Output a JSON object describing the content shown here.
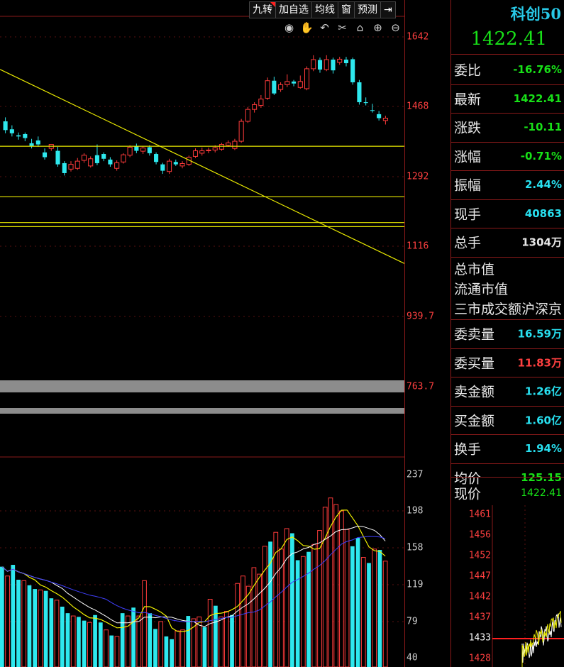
{
  "toolbar": {
    "buttons": [
      "九转",
      "加自选",
      "均线",
      "窗",
      "预测"
    ],
    "collapse_icon": "arrow-right-bar-icon"
  },
  "tools": [
    "eye-icon",
    "hand-icon",
    "undo-icon",
    "scissors-icon",
    "lock-icon",
    "zoom-in-icon",
    "zoom-out-icon"
  ],
  "price_axis": {
    "labels": [
      "1642",
      "1468",
      "1292",
      "1116",
      "939.7",
      "763.7"
    ]
  },
  "volume_axis": {
    "labels": [
      "237",
      "198",
      "158",
      "119",
      "79",
      "40"
    ]
  },
  "colors": {
    "up": "#ff3b3b",
    "down": "#2ee8ee",
    "drawn_line": "#e8e800",
    "quote_green": "#18e018",
    "quote_cyan": "#28e0f0",
    "quote_red": "#ff4040"
  },
  "chart_data": {
    "type": "candlestick",
    "price_range": [
      763.7,
      1642
    ],
    "volume_range": [
      40,
      237
    ],
    "candles": [
      [
        1430,
        1408,
        1440,
        1400,
        "down"
      ],
      [
        1410,
        1400,
        1420,
        1392,
        "down"
      ],
      [
        1395,
        1392,
        1402,
        1384,
        "down"
      ],
      [
        1398,
        1388,
        1402,
        1380,
        "down"
      ],
      [
        1375,
        1368,
        1386,
        1362,
        "down"
      ],
      [
        1382,
        1372,
        1392,
        1366,
        "down"
      ],
      [
        1352,
        1340,
        1362,
        1334,
        "down"
      ],
      [
        1362,
        1372,
        1372,
        1356,
        "up"
      ],
      [
        1356,
        1322,
        1366,
        1316,
        "down"
      ],
      [
        1325,
        1300,
        1330,
        1294,
        "down"
      ],
      [
        1310,
        1322,
        1330,
        1304,
        "up"
      ],
      [
        1312,
        1330,
        1338,
        1308,
        "up"
      ],
      [
        1332,
        1345,
        1350,
        1326,
        "up"
      ],
      [
        1318,
        1336,
        1342,
        1314,
        "up"
      ],
      [
        1345,
        1325,
        1372,
        1320,
        "down"
      ],
      [
        1348,
        1336,
        1352,
        1330,
        "down"
      ],
      [
        1334,
        1322,
        1340,
        1316,
        "down"
      ],
      [
        1312,
        1326,
        1332,
        1306,
        "up"
      ],
      [
        1328,
        1346,
        1350,
        1324,
        "up"
      ],
      [
        1345,
        1365,
        1370,
        1340,
        "up"
      ],
      [
        1368,
        1356,
        1374,
        1350,
        "down"
      ],
      [
        1355,
        1363,
        1368,
        1348,
        "up"
      ],
      [
        1365,
        1350,
        1370,
        1344,
        "down"
      ],
      [
        1348,
        1328,
        1352,
        1322,
        "down"
      ],
      [
        1322,
        1306,
        1326,
        1298,
        "down"
      ],
      [
        1304,
        1330,
        1336,
        1298,
        "up"
      ],
      [
        1328,
        1322,
        1334,
        1318,
        "down"
      ],
      [
        1318,
        1324,
        1330,
        1312,
        "up"
      ],
      [
        1322,
        1340,
        1344,
        1318,
        "up"
      ],
      [
        1342,
        1356,
        1362,
        1338,
        "up"
      ],
      [
        1350,
        1356,
        1364,
        1344,
        "up"
      ],
      [
        1356,
        1358,
        1364,
        1350,
        "up"
      ],
      [
        1358,
        1364,
        1370,
        1352,
        "up"
      ],
      [
        1360,
        1372,
        1376,
        1356,
        "up"
      ],
      [
        1370,
        1376,
        1382,
        1366,
        "up"
      ],
      [
        1362,
        1380,
        1386,
        1358,
        "up"
      ],
      [
        1380,
        1430,
        1436,
        1376,
        "up"
      ],
      [
        1430,
        1460,
        1466,
        1426,
        "up"
      ],
      [
        1460,
        1472,
        1478,
        1452,
        "up"
      ],
      [
        1470,
        1486,
        1496,
        1464,
        "up"
      ],
      [
        1488,
        1532,
        1540,
        1484,
        "up"
      ],
      [
        1532,
        1500,
        1542,
        1496,
        "down"
      ],
      [
        1510,
        1522,
        1528,
        1504,
        "up"
      ],
      [
        1522,
        1530,
        1548,
        1516,
        "up"
      ],
      [
        1530,
        1525,
        1534,
        1518,
        "down"
      ],
      [
        1515,
        1530,
        1545,
        1512,
        "up"
      ],
      [
        1512,
        1562,
        1568,
        1508,
        "up"
      ],
      [
        1562,
        1585,
        1596,
        1556,
        "up"
      ],
      [
        1584,
        1560,
        1590,
        1552,
        "down"
      ],
      [
        1560,
        1585,
        1596,
        1556,
        "up"
      ],
      [
        1585,
        1558,
        1590,
        1550,
        "down"
      ],
      [
        1578,
        1586,
        1592,
        1572,
        "up"
      ],
      [
        1585,
        1576,
        1592,
        1568,
        "down"
      ],
      [
        1586,
        1528,
        1590,
        1522,
        "down"
      ],
      [
        1528,
        1478,
        1534,
        1472,
        "down"
      ],
      [
        1478,
        1476,
        1490,
        1470,
        "down"
      ],
      [
        1458,
        1458,
        1474,
        1452,
        "down"
      ],
      [
        1448,
        1438,
        1456,
        1432,
        "down"
      ],
      [
        1438,
        1432,
        1444,
        1422,
        "up"
      ]
    ],
    "volumes": [
      [
        138,
        "down"
      ],
      [
        128,
        "up"
      ],
      [
        140,
        "down"
      ],
      [
        124,
        "down"
      ],
      [
        123,
        "up"
      ],
      [
        118,
        "down"
      ],
      [
        114,
        "down"
      ],
      [
        113,
        "up"
      ],
      [
        112,
        "down"
      ],
      [
        104,
        "down"
      ],
      [
        102,
        "up"
      ],
      [
        95,
        "down"
      ],
      [
        88,
        "down"
      ],
      [
        85,
        "up"
      ],
      [
        84,
        "down"
      ],
      [
        80,
        "down"
      ],
      [
        78,
        "up"
      ],
      [
        86,
        "down"
      ],
      [
        78,
        "down"
      ],
      [
        70,
        "up"
      ],
      [
        64,
        "down"
      ],
      [
        63,
        "up"
      ],
      [
        88,
        "down"
      ],
      [
        85,
        "up"
      ],
      [
        94,
        "down"
      ],
      [
        85,
        "up"
      ],
      [
        123,
        "up"
      ],
      [
        88,
        "down"
      ],
      [
        71,
        "down"
      ],
      [
        79,
        "up"
      ],
      [
        63,
        "down"
      ],
      [
        60,
        "down"
      ],
      [
        69,
        "up"
      ],
      [
        70,
        "up"
      ],
      [
        85,
        "down"
      ],
      [
        82,
        "up"
      ],
      [
        84,
        "up"
      ],
      [
        73,
        "down"
      ],
      [
        103,
        "up"
      ],
      [
        96,
        "down"
      ],
      [
        84,
        "up"
      ],
      [
        90,
        "up"
      ],
      [
        86,
        "down"
      ],
      [
        120,
        "up"
      ],
      [
        128,
        "up"
      ],
      [
        117,
        "up"
      ],
      [
        137,
        "up"
      ],
      [
        130,
        "up"
      ],
      [
        160,
        "up"
      ],
      [
        165,
        "down"
      ],
      [
        175,
        "up"
      ],
      [
        157,
        "up"
      ],
      [
        179,
        "up"
      ],
      [
        174,
        "down"
      ],
      [
        145,
        "down"
      ],
      [
        149,
        "up"
      ],
      [
        154,
        "down"
      ],
      [
        162,
        "up"
      ],
      [
        177,
        "up"
      ],
      [
        202,
        "up"
      ],
      [
        212,
        "up"
      ],
      [
        205,
        "up"
      ],
      [
        198,
        "up"
      ],
      [
        178,
        "up"
      ],
      [
        160,
        "down"
      ],
      [
        169,
        "down"
      ],
      [
        148,
        "up"
      ],
      [
        142,
        "down"
      ],
      [
        157,
        "up"
      ],
      [
        156,
        "down"
      ],
      [
        144,
        "up"
      ]
    ],
    "horizontal_lines": [
      1367.4,
      1240.8,
      1175.8,
      1165.7
    ],
    "trend_line": [
      [
        1,
        1560.4
      ],
      [
        545,
        1095.3
      ]
    ]
  },
  "panel": {
    "name": "科创50",
    "price": "1422.41",
    "rows": [
      {
        "label": "委比",
        "value": "-16.76%",
        "color": "green"
      },
      {
        "label": "最新",
        "value": "1422.41",
        "color": "green"
      },
      {
        "label": "涨跌",
        "value": "-10.11",
        "color": "green"
      },
      {
        "label": "涨幅",
        "value": "-0.71%",
        "color": "green"
      },
      {
        "label": "振幅",
        "value": "2.44%",
        "color": "cyan"
      },
      {
        "label": "现手",
        "value": "40863",
        "color": "cyan"
      },
      {
        "label": "总手",
        "value": "1304万",
        "color": "white"
      }
    ],
    "group": [
      "总市值",
      "流通市值",
      "三市成交额沪深京"
    ],
    "rows2": [
      {
        "label": "委卖量",
        "value": "16.59万",
        "color": "cyan"
      },
      {
        "label": "委买量",
        "value": "11.83万",
        "color": "red"
      },
      {
        "label": "卖金额",
        "value": "1.26亿",
        "color": "cyan"
      },
      {
        "label": "买金额",
        "value": "1.60亿",
        "color": "cyan"
      },
      {
        "label": "换手",
        "value": "1.94%",
        "color": "cyan"
      },
      {
        "label": "均价",
        "value": "125.15",
        "color": "green"
      }
    ],
    "current_label": "现价",
    "current_value": "1422.41",
    "mini_axis": [
      "1461",
      "1456",
      "1452",
      "1447",
      "1442",
      "1437",
      "1433",
      "1428"
    ]
  }
}
